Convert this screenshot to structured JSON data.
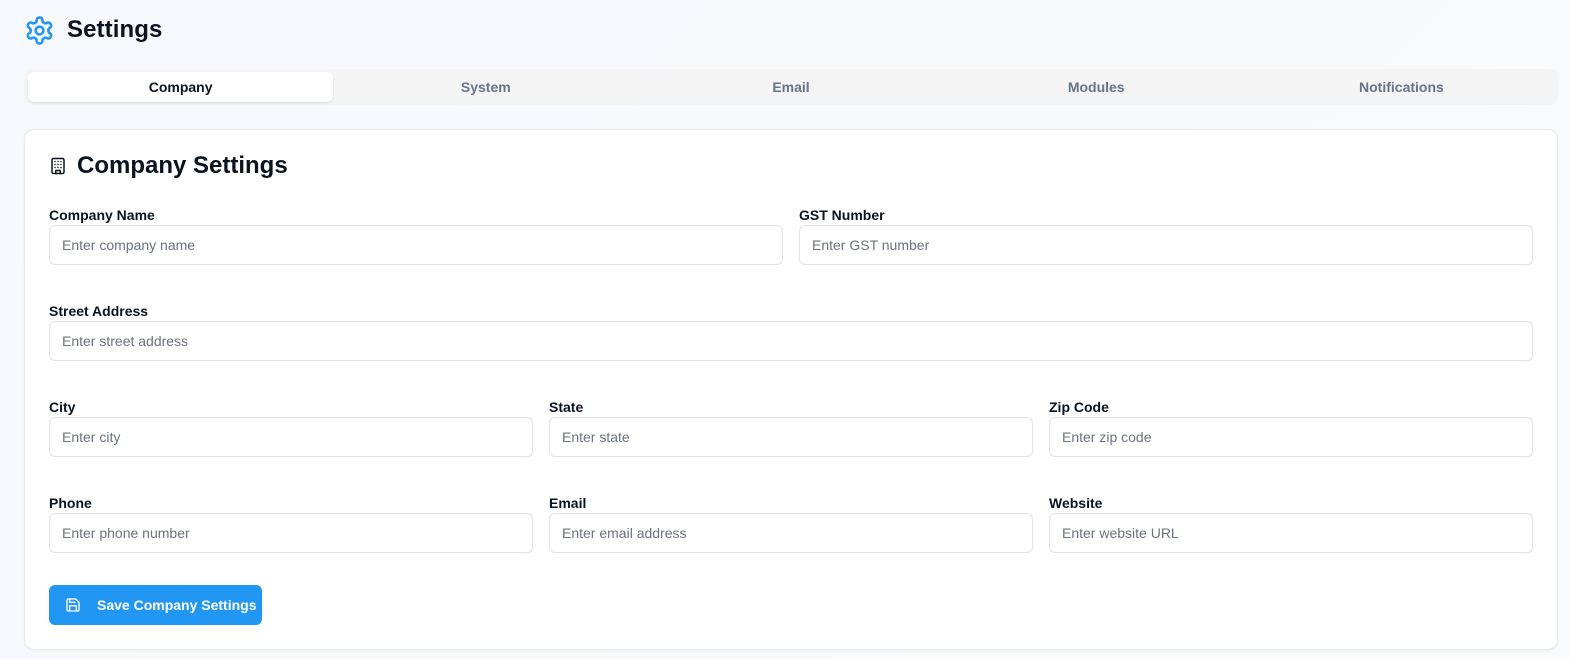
{
  "header": {
    "title": "Settings",
    "icon": "gear-icon",
    "icon_color": "#2196f3"
  },
  "tabs": [
    {
      "label": "Company",
      "active": true
    },
    {
      "label": "System",
      "active": false
    },
    {
      "label": "Email",
      "active": false
    },
    {
      "label": "Modules",
      "active": false
    },
    {
      "label": "Notifications",
      "active": false
    }
  ],
  "card": {
    "title": "Company Settings",
    "icon": "building-icon",
    "fields": {
      "company_name": {
        "label": "Company Name",
        "placeholder": "Enter company name",
        "value": ""
      },
      "gst_number": {
        "label": "GST Number",
        "placeholder": "Enter GST number",
        "value": ""
      },
      "street_address": {
        "label": "Street Address",
        "placeholder": "Enter street address",
        "value": ""
      },
      "city": {
        "label": "City",
        "placeholder": "Enter city",
        "value": ""
      },
      "state": {
        "label": "State",
        "placeholder": "Enter state",
        "value": ""
      },
      "zip_code": {
        "label": "Zip Code",
        "placeholder": "Enter zip code",
        "value": ""
      },
      "phone": {
        "label": "Phone",
        "placeholder": "Enter phone number",
        "value": ""
      },
      "email": {
        "label": "Email",
        "placeholder": "Enter email address",
        "value": ""
      },
      "website": {
        "label": "Website",
        "placeholder": "Enter website URL",
        "value": ""
      }
    },
    "save_button": {
      "label": "Save Company Settings",
      "icon": "save-icon",
      "color": "#2196f3"
    }
  }
}
